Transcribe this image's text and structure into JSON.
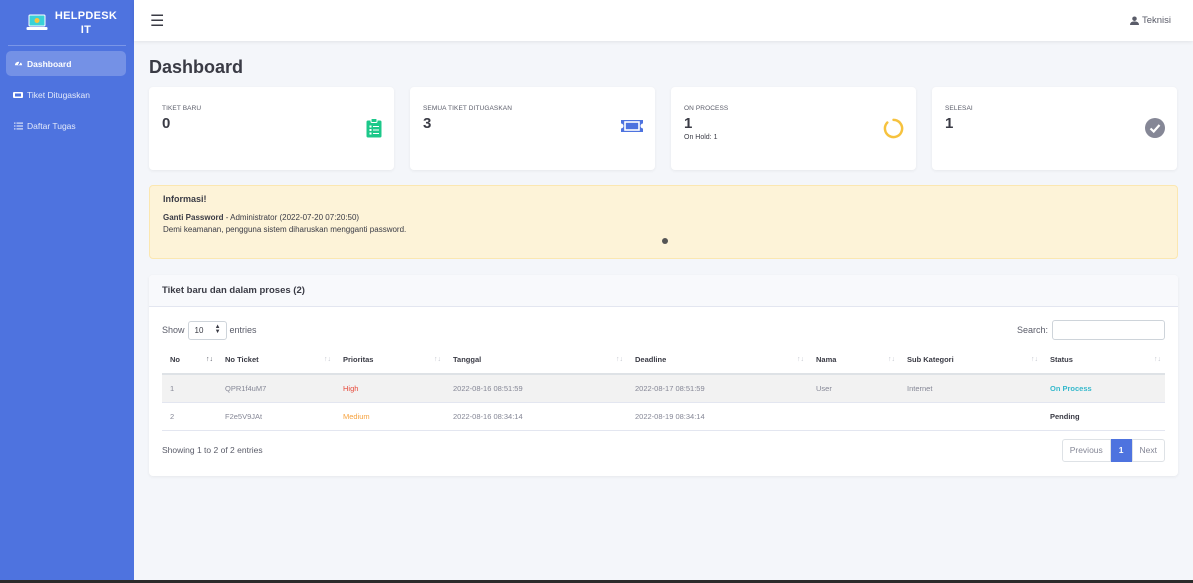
{
  "brand": {
    "line1": "HELPDESK",
    "line2": "IT"
  },
  "sidebar": {
    "items": [
      {
        "label": "Dashboard",
        "icon": "tachometer-icon",
        "active": true
      },
      {
        "label": "Tiket Ditugaskan",
        "icon": "ticket-icon",
        "active": false
      },
      {
        "label": "Daftar Tugas",
        "icon": "list-icon",
        "active": false
      }
    ]
  },
  "topbar": {
    "user_label": "Teknisi"
  },
  "page": {
    "title": "Dashboard"
  },
  "stats": [
    {
      "label": "TIKET BARU",
      "value": "0",
      "icon": "clipboard-list-icon",
      "color": "#1cc88a"
    },
    {
      "label": "SEMUA TIKET DITUGASKAN",
      "value": "3",
      "icon": "ticket-icon",
      "color": "#4e73df"
    },
    {
      "label": "ON PROCESS",
      "value": "1",
      "sub": "On Hold: 1",
      "icon": "circle-notch-icon",
      "color": "#f6c23e"
    },
    {
      "label": "SELESAI",
      "value": "1",
      "icon": "check-circle-icon",
      "color": "#858796"
    }
  ],
  "alert": {
    "title": "Informasi!",
    "subject": "Ganti Password",
    "meta": " - Administrator (2022-07-20 07:20:50)",
    "description": "Demi keamanan, pengguna sistem diharuskan mengganti password."
  },
  "table_card": {
    "title": "Tiket baru dan dalam proses (2)",
    "show_label": "Show",
    "entries_value": "10",
    "entries_label": "entries",
    "search_label": "Search:",
    "search_value": "",
    "columns": [
      "No",
      "No Ticket",
      "Prioritas",
      "Tanggal",
      "Deadline",
      "Nama",
      "Sub Kategori",
      "Status"
    ],
    "rows": [
      {
        "no": "1",
        "ticket": "QPR1f4uM7",
        "priority": "High",
        "tanggal": "2022-08-16 08:51:59",
        "deadline": "2022-08-17 08:51:59",
        "nama": "User",
        "sub_kategori": "Internet",
        "status": "On Process"
      },
      {
        "no": "2",
        "ticket": "F2e5V9JAt",
        "priority": "Medium",
        "tanggal": "2022-08-16 08:34:14",
        "deadline": "2022-08-19 08:34:14",
        "nama": "",
        "sub_kategori": "",
        "status": "Pending"
      }
    ],
    "info": "Showing 1 to 2 of 2 entries",
    "pagination": {
      "previous": "Previous",
      "current": "1",
      "next": "Next"
    }
  },
  "colors": {
    "sidebar": "#4e73df",
    "accent": "#4e73df",
    "alert_bg": "#fdf3d8"
  }
}
